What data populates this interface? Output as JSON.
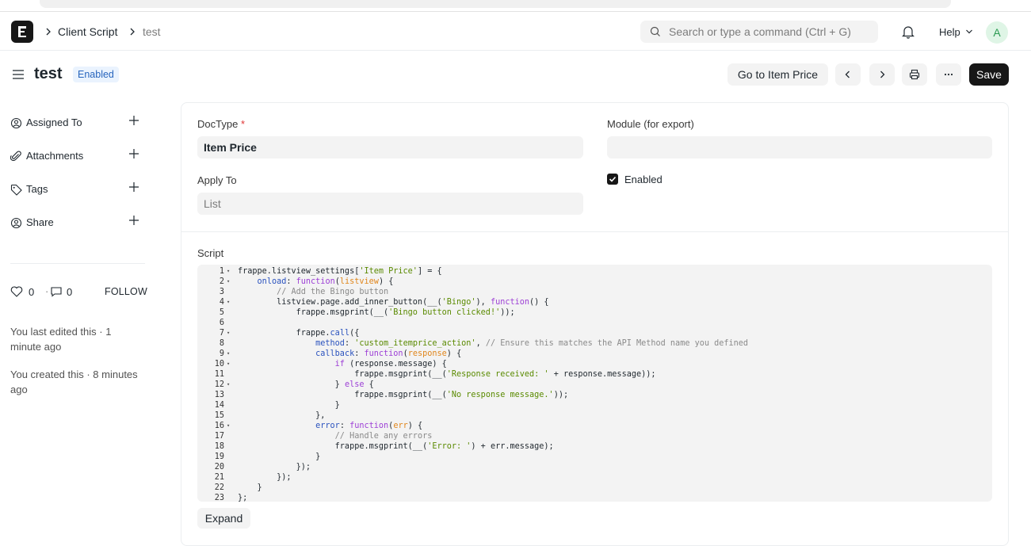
{
  "navbar": {
    "breadcrumbs": [
      "Client Script",
      "test"
    ],
    "search_placeholder": "Search or type a command (Ctrl + G)",
    "help_label": "Help",
    "avatar_initial": "A"
  },
  "page": {
    "title": "test",
    "status": "Enabled",
    "actions": {
      "goto_label": "Go to Item Price",
      "save_label": "Save"
    }
  },
  "sidebar": {
    "items": [
      {
        "label": "Assigned To",
        "icon": "assign-icon"
      },
      {
        "label": "Attachments",
        "icon": "paperclip-icon"
      },
      {
        "label": "Tags",
        "icon": "tag-icon"
      },
      {
        "label": "Share",
        "icon": "share-icon"
      }
    ],
    "likes": "0",
    "comments": "0",
    "follow_label": "FOLLOW",
    "activity": [
      "You last edited this · 1 minute ago",
      "You created this · 8 minutes ago"
    ]
  },
  "form": {
    "doctype": {
      "label": "DocType",
      "required_mark": "*",
      "value": "Item Price"
    },
    "module": {
      "label": "Module (for export)",
      "value": ""
    },
    "apply_to": {
      "label": "Apply To",
      "value": "List"
    },
    "enabled": {
      "label": "Enabled",
      "checked": true
    },
    "script": {
      "label": "Script",
      "lines": [
        "frappe.listview_settings['Item Price'] = {",
        "    onload: function(listview) {",
        "        // Add the Bingo button",
        "        listview.page.add_inner_button(__('Bingo'), function() {",
        "            frappe.msgprint(__('Bingo button clicked!'));",
        "",
        "            frappe.call({",
        "                method: 'custom_itemprice_action', // Ensure this matches the API Method name you defined",
        "                callback: function(response) {",
        "                    if (response.message) {",
        "                        frappe.msgprint(__('Response received: ' + response.message));",
        "                    } else {",
        "                        frappe.msgprint(__('No response message.'));",
        "                    }",
        "                },",
        "                error: function(err) {",
        "                    // Handle any errors",
        "                    frappe.msgprint(__('Error: ') + err.message);",
        "                }",
        "            });",
        "        });",
        "    }",
        "};"
      ],
      "fold_lines": [
        1,
        2,
        4,
        7,
        9,
        10,
        12,
        16
      ],
      "expand_label": "Expand"
    }
  }
}
